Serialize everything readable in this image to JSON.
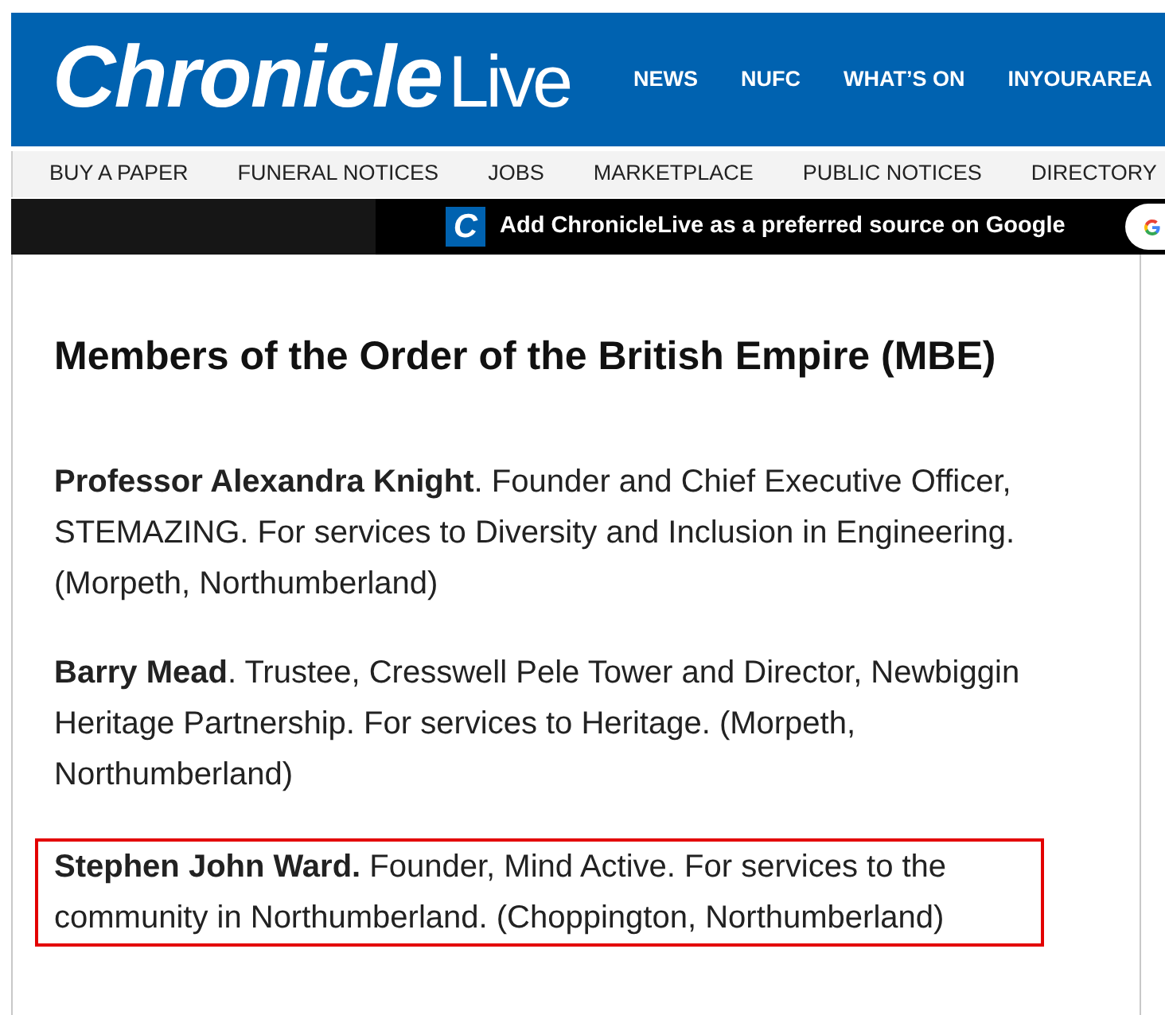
{
  "header": {
    "logo": {
      "bold": "Chronicle",
      "light": "Live"
    },
    "nav": [
      "NEWS",
      "NUFC",
      "WHAT’S ON",
      "INYOURAREA"
    ]
  },
  "secondary_nav": [
    "BUY A PAPER",
    "FUNERAL NOTICES",
    "JOBS",
    "MARKETPLACE",
    "PUBLIC NOTICES",
    "DIRECTORY"
  ],
  "promo_bar": {
    "brand_letter": "C",
    "text": "Add ChronicleLive as a preferred source on Google"
  },
  "article": {
    "heading": "Members of the Order of the British Empire (MBE)",
    "entries": [
      {
        "text": "**Professor Alexandra Knight**. Founder and Chief Executive Officer, STEMAZING. For services to Diversity and Inclusion in Engineering. (Morpeth, Northumberland)",
        "highlighted": false
      },
      {
        "text": "**Barry Mead**. Trustee, Cresswell Pele Tower and Director, Newbiggin Heritage Partnership. For services to Heritage. (Morpeth, Northumberland)",
        "highlighted": false
      },
      {
        "text": "**Stephen John Ward.** Founder, Mind Active. For services to the community in Northumberland. (Choppington, Northumberland)",
        "highlighted": true
      }
    ]
  }
}
